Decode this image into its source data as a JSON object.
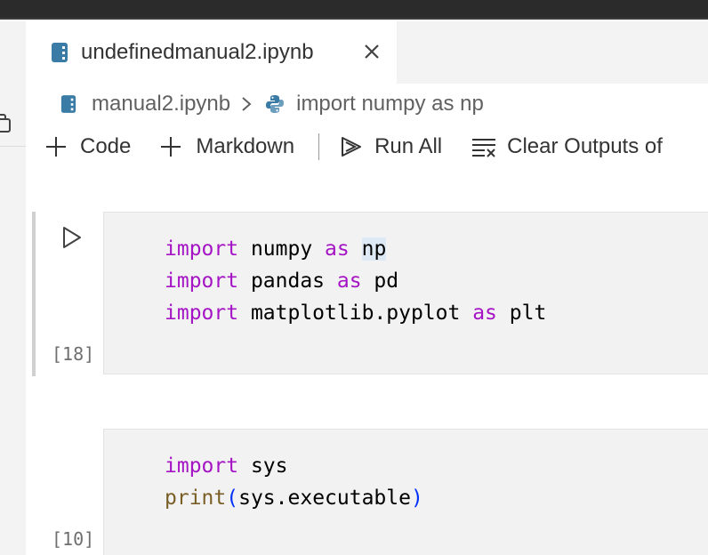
{
  "window": {
    "topbar_color": "#2b2b2c"
  },
  "tab": {
    "title": "undefinedmanual2.ipynb",
    "icon": "notebook-icon",
    "close_icon": "close-icon"
  },
  "breadcrumb": {
    "file": "manual2.ipynb",
    "separator_icon": "chevron-right-icon",
    "symbol_icon": "python-icon",
    "symbol": "import numpy as np"
  },
  "toolbar": {
    "add_code_label": "Code",
    "add_markdown_label": "Markdown",
    "run_all_label": "Run All",
    "clear_outputs_label": "Clear Outputs of"
  },
  "cells": [
    {
      "execution_count": "[18]",
      "lines": [
        [
          {
            "t": "import",
            "k": "kw"
          },
          {
            "t": " numpy "
          },
          {
            "t": "as",
            "k": "kw"
          },
          {
            "t": " "
          },
          {
            "t": "np",
            "k": "hl"
          }
        ],
        [
          {
            "t": "import",
            "k": "kw"
          },
          {
            "t": " pandas "
          },
          {
            "t": "as",
            "k": "kw"
          },
          {
            "t": " pd"
          }
        ],
        [
          {
            "t": "import",
            "k": "kw"
          },
          {
            "t": " matplotlib.pyplot "
          },
          {
            "t": "as",
            "k": "kw"
          },
          {
            "t": " plt"
          }
        ]
      ]
    },
    {
      "execution_count": "[10]",
      "lines": [
        [
          {
            "t": "import",
            "k": "kw"
          },
          {
            "t": " sys"
          }
        ],
        [
          {
            "t": "print",
            "k": "fn"
          },
          {
            "t": "(",
            "k": "pr"
          },
          {
            "t": "sys.executable"
          },
          {
            "t": ")",
            "k": "pr"
          }
        ]
      ]
    }
  ],
  "colors": {
    "keyword": "#a514c4",
    "function": "#795e26",
    "paren": "#0431fa",
    "cell_bg": "#f2f2f2",
    "accent_icon": "#3a7ca5"
  }
}
